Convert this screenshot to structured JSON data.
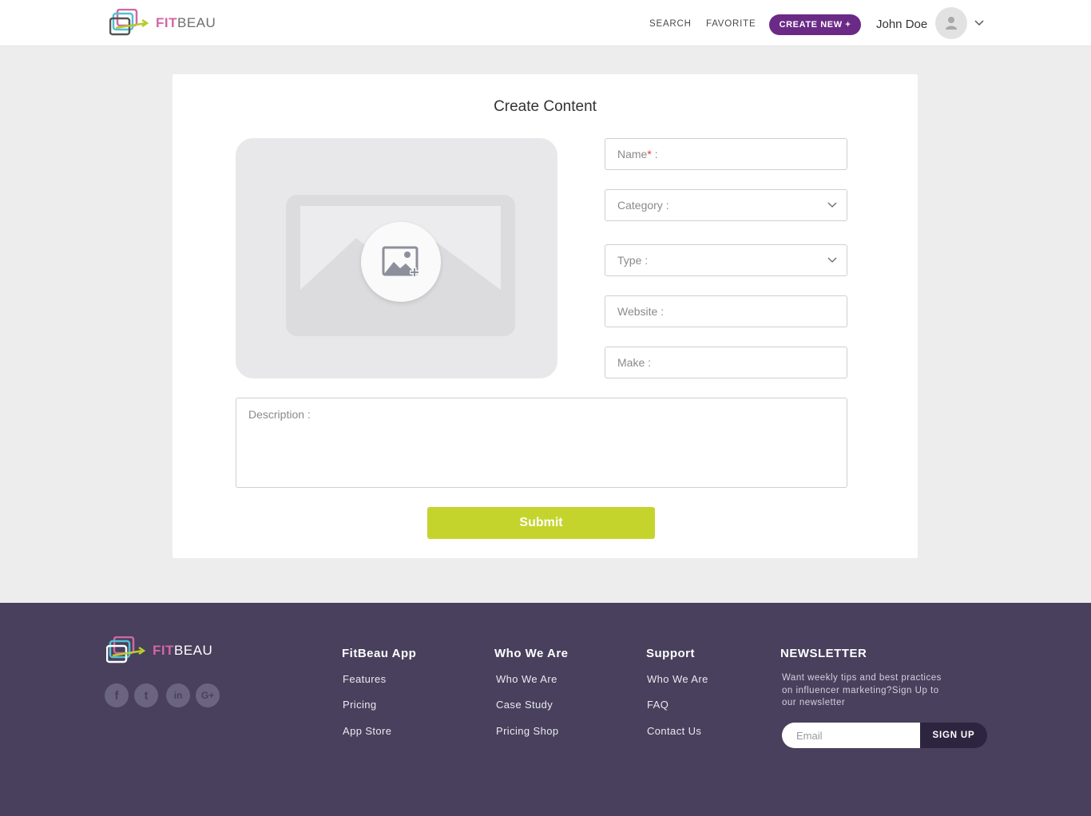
{
  "brand": {
    "fit": "FIT",
    "beau": "BEAU"
  },
  "header": {
    "nav": [
      "SEARCH",
      "FAVORITE"
    ],
    "create_label": "CREATE NEW +",
    "user_name": "John Doe"
  },
  "form": {
    "title": "Create Content",
    "name_label": "Name",
    "name_required": "*",
    "name_suffix": " :",
    "category_label": "Category :",
    "type_label": "Type :",
    "website_label": "Website :",
    "make_label": "Make :",
    "description_label": "Description :",
    "submit_label": "Submit"
  },
  "footer": {
    "social": [
      "f",
      "t",
      "in",
      "G+"
    ],
    "columns": [
      {
        "title": "FitBeau App",
        "links": [
          "Features",
          "Pricing",
          "App Store"
        ]
      },
      {
        "title": "Who We Are",
        "links": [
          "Who We Are",
          "Case Study",
          "Pricing Shop"
        ]
      },
      {
        "title": "Support",
        "links": [
          "Who We Are",
          "FAQ",
          "Contact Us"
        ]
      }
    ],
    "newsletter": {
      "title": "NEWSLETTER",
      "text": "Want weekly tips and best practices on influencer marketing?Sign Up to our newsletter",
      "placeholder": "Email",
      "button": "SIGN UP"
    }
  },
  "colors": {
    "accent_purple": "#6a2a86",
    "submit_green": "#c5d42c",
    "footer_bg": "#48405c",
    "brand_pink": "#d466a5"
  }
}
